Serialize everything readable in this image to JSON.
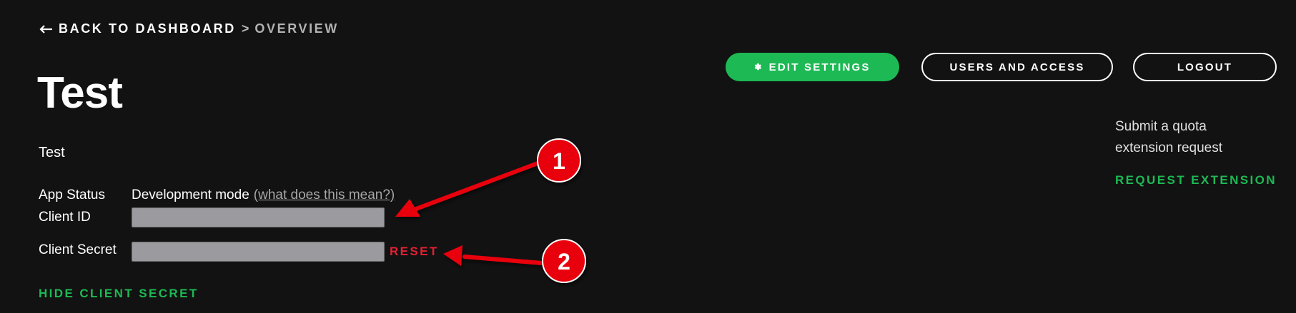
{
  "breadcrumb": {
    "back_label": "BACK TO DASHBOARD",
    "separator": ">",
    "current": "OVERVIEW"
  },
  "app": {
    "title": "Test",
    "description": "Test"
  },
  "details": {
    "app_status_label": "App Status",
    "app_status_value": "Development mode",
    "app_status_link": "(what does this mean?)",
    "client_id_label": "Client ID",
    "client_secret_label": "Client Secret",
    "reset_label": "RESET",
    "hide_secret_label": "HIDE CLIENT SECRET"
  },
  "header_buttons": {
    "edit_settings": "EDIT SETTINGS",
    "users_and_access": "USERS AND ACCESS",
    "logout": "LOGOUT"
  },
  "quota": {
    "text": "Submit a quota extension request",
    "request_label": "REQUEST EXTENSION"
  },
  "annotations": {
    "badge_1": "1",
    "badge_2": "2"
  },
  "colors": {
    "background": "#121212",
    "accent_green": "#1db954",
    "danger_red": "#e22134",
    "annotation_red": "#e8000b",
    "masked_field": "#9b9a9f"
  },
  "icons": {
    "back": "arrow-left-icon",
    "settings": "gear-icon"
  }
}
